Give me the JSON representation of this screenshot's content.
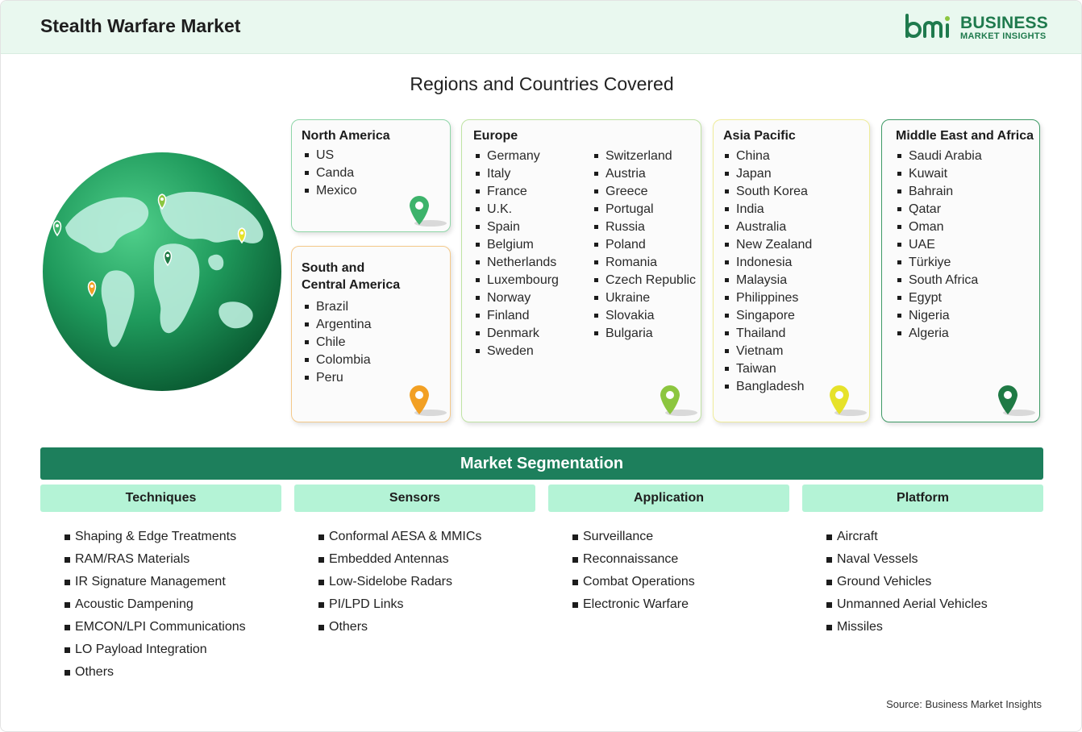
{
  "header": {
    "title": "Stealth Warfare Market",
    "logo_top": "BUSINESS",
    "logo_bottom": "MARKET INSIGHTS",
    "logo_mark": "bmi"
  },
  "regions_title": "Regions and Countries Covered",
  "regions": {
    "north_america": {
      "title": "North America",
      "items": [
        "US",
        "Canda",
        "Mexico"
      ],
      "pin_color": "#3db36b",
      "border": "#8fd6a8"
    },
    "south_central_america": {
      "title_line1": "South and",
      "title_line2": "Central America",
      "items": [
        "Brazil",
        "Argentina",
        "Chile",
        "Colombia",
        "Peru"
      ],
      "pin_color": "#f2a024",
      "border": "#f4c98a"
    },
    "europe": {
      "title": "Europe",
      "col1": [
        "Germany",
        "Italy",
        "France",
        "U.K.",
        "Spain",
        "Belgium",
        "Netherlands",
        "Luxembourg",
        "Norway",
        "Finland",
        "Denmark",
        "Sweden"
      ],
      "col2": [
        "Switzerland",
        "Austria",
        "Greece",
        "Portugal",
        "Russia",
        "Poland",
        "Romania",
        "Czech Republic",
        "Ukraine",
        "Slovakia",
        "Bulgaria"
      ],
      "pin_color": "#8cc63f",
      "border": "#bfe3a4"
    },
    "asia_pacific": {
      "title": "Asia Pacific",
      "items": [
        "China",
        "Japan",
        "South Korea",
        "India",
        "Australia",
        "New Zealand",
        "Indonesia",
        "Malaysia",
        "Philippines",
        "Singapore",
        "Thailand",
        "Vietnam",
        "Taiwan",
        "Bangladesh"
      ],
      "pin_color": "#e6e22a",
      "border": "#efec9a"
    },
    "mea": {
      "title": "Middle East and Africa",
      "items": [
        "Saudi Arabia",
        "Kuwait",
        "Bahrain",
        "Qatar",
        "Oman",
        "UAE",
        "Türkiye",
        "South Africa",
        "Egypt",
        "Nigeria",
        "Algeria"
      ],
      "pin_color": "#1f7a45",
      "border": "#3f9a66"
    }
  },
  "segmentation": {
    "title": "Market Segmentation",
    "columns": [
      {
        "header": "Techniques",
        "items": [
          "Shaping & Edge Treatments",
          "RAM/RAS Materials",
          "IR Signature Management",
          "Acoustic Dampening",
          "EMCON/LPI Communications",
          "LO Payload Integration",
          "Others"
        ]
      },
      {
        "header": "Sensors",
        "items": [
          "Conformal AESA & MMICs",
          "Embedded Antennas",
          "Low-Sidelobe Radars",
          "PI/LPD Links",
          "Others"
        ]
      },
      {
        "header": "Application",
        "items": [
          "Surveillance",
          "Reconnaissance",
          "Combat Operations",
          "Electronic Warfare"
        ]
      },
      {
        "header": "Platform",
        "items": [
          "Aircraft",
          "Naval Vessels",
          "Ground Vehicles",
          "Unmanned Aerial Vehicles",
          "Missiles"
        ]
      }
    ]
  },
  "source": "Source: Business Market Insights",
  "colors": {
    "accent": "#1d7f5c",
    "header_bg": "#e9f8ef",
    "segment_head": "#b4f3d6"
  }
}
